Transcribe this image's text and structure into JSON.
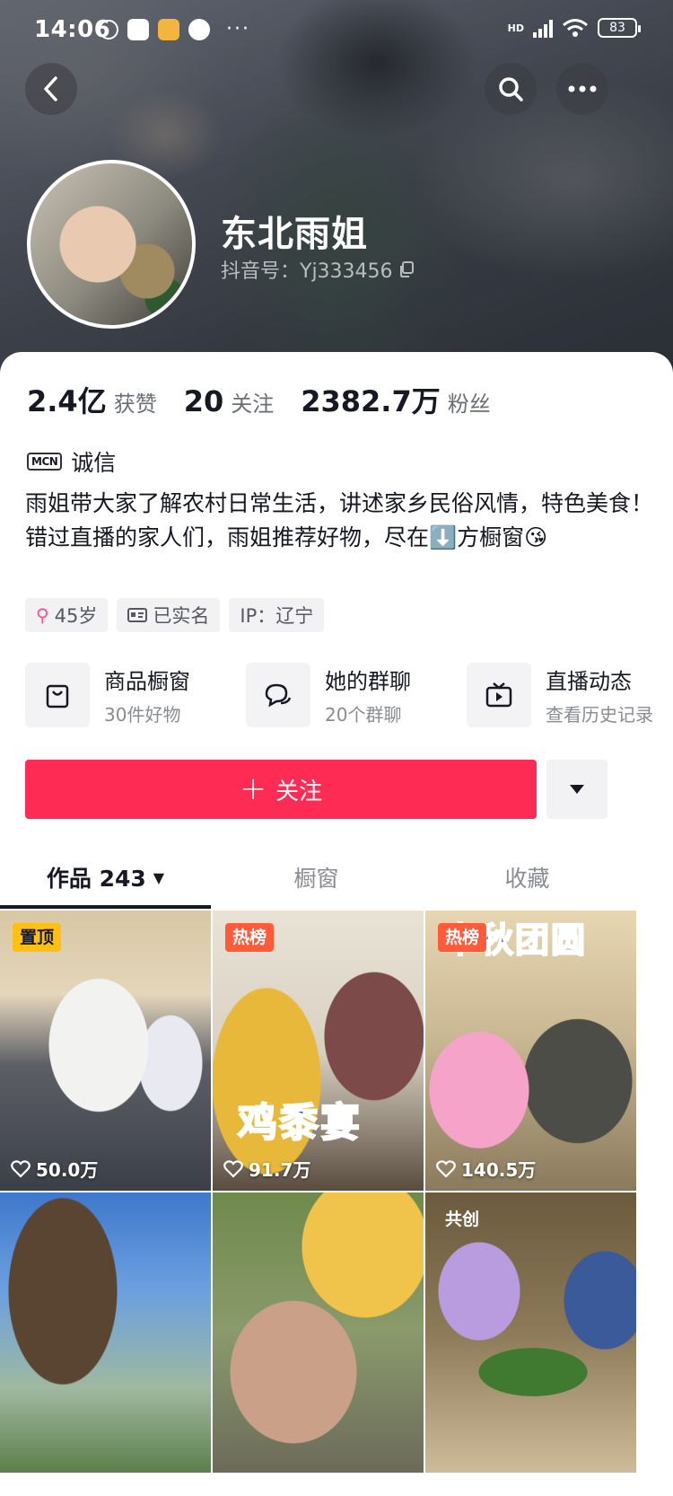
{
  "status_bar": {
    "time": "14:06",
    "dots": "···",
    "network": "HD",
    "battery": "83"
  },
  "header": {
    "icons": {
      "back": "back-icon",
      "search": "search-icon",
      "more": "more-icon"
    }
  },
  "profile": {
    "name": "东北雨姐",
    "douyin_id": "抖音号：Yj333456"
  },
  "stats": [
    {
      "value": "2.4亿",
      "label": "获赞"
    },
    {
      "value": "20",
      "label": "关注"
    },
    {
      "value": "2382.7万",
      "label": "粉丝"
    }
  ],
  "mcn": {
    "badge": "MCN",
    "label": "诚信"
  },
  "bio": {
    "line1": "雨姐带大家了解农村日常生活，讲述家乡民俗风情，特色美食！",
    "line2": "错过直播的家人们，雨姐推荐好物，尽在⬇️方橱窗😘"
  },
  "tags": [
    {
      "label": "45岁",
      "icon": "female-icon"
    },
    {
      "label": "已实名",
      "icon": "id-card-icon"
    },
    {
      "label": "IP：辽宁",
      "icon": ""
    }
  ],
  "features": [
    {
      "title": "商品橱窗",
      "subtitle": "30件好物",
      "icon": "shopping-bag-icon"
    },
    {
      "title": "她的群聊",
      "subtitle": "20个群聊",
      "icon": "chat-icon"
    },
    {
      "title": "直播动态",
      "subtitle": "查看历史记录",
      "icon": "live-tv-icon"
    }
  ],
  "actions": {
    "follow_label": "关注",
    "follow_icon": "+"
  },
  "tabs": [
    {
      "label": "作品 243",
      "active": true
    },
    {
      "label": "橱窗",
      "active": false
    },
    {
      "label": "收藏",
      "active": false
    }
  ],
  "videos": [
    {
      "badge": "置顶",
      "badge_type": "pin",
      "likes": "50.0万",
      "overlay": ""
    },
    {
      "badge": "热榜",
      "badge_type": "hot",
      "likes": "91.7万",
      "overlay": "鸡黍宴"
    },
    {
      "badge": "热榜",
      "badge_type": "hot",
      "likes": "140.5万",
      "overlay": "中秋团圆"
    },
    {
      "badge": "",
      "badge_type": "",
      "likes": "",
      "overlay": ""
    },
    {
      "badge": "",
      "badge_type": "",
      "likes": "",
      "overlay": ""
    },
    {
      "badge": "共创",
      "badge_type": "co",
      "likes": "",
      "overlay": ""
    }
  ],
  "colors": {
    "accent": "#fe2c55",
    "pin_badge": "#ffc012",
    "hot_badge": "#ff5b3a"
  }
}
